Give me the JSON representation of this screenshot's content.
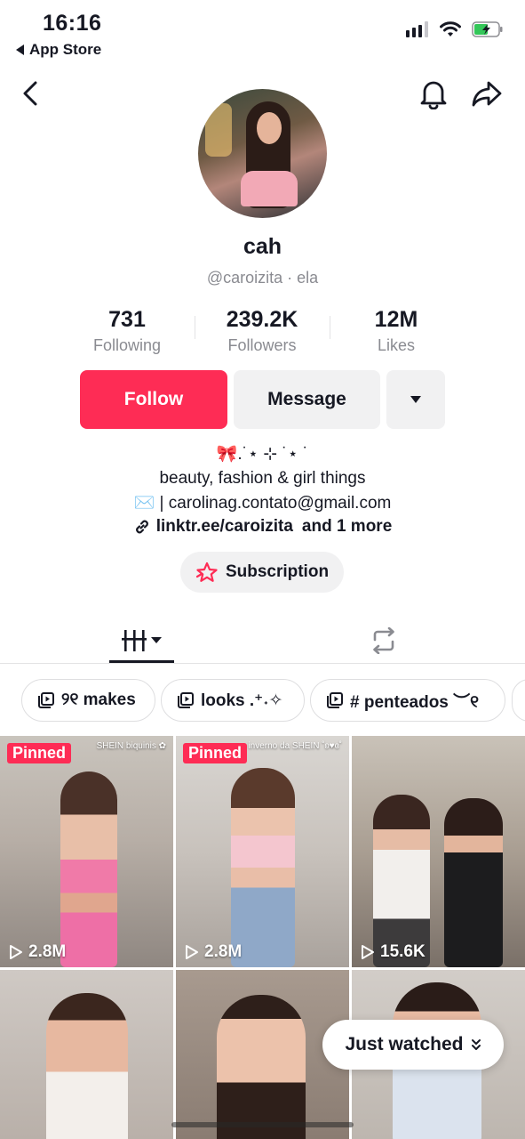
{
  "status_bar": {
    "time": "16:16",
    "back_app_label": "App Store"
  },
  "profile": {
    "display_name": "cah",
    "handle_line": "@caroizita · ela",
    "stats": [
      {
        "value": "731",
        "label": "Following"
      },
      {
        "value": "239.2K",
        "label": "Followers"
      },
      {
        "value": "12M",
        "label": "Likes"
      }
    ]
  },
  "actions": {
    "follow": "Follow",
    "message": "Message"
  },
  "bio": {
    "line1": "🎀.˙⋆ ⊹ ˙⋆ ˙",
    "line2": "beauty, fashion & girl things",
    "line3": "✉️ | carolinag.contato@gmail.com",
    "link_text": "linktr.ee/caroizita",
    "link_more": "and 1 more"
  },
  "subscription_label": "Subscription",
  "playlists": [
    {
      "label": "୨୧ makes"
    },
    {
      "label": "looks .⁺˖✧"
    },
    {
      "label": "# penteados ︶୧"
    }
  ],
  "videos": [
    {
      "pinned": "Pinned",
      "views": "2.8M",
      "caption": "SHEIN biquinis ✿"
    },
    {
      "pinned": "Pinned",
      "views": "2.8M",
      "caption": "inverno da SHEIN ˚ʚ♥ɞ˚"
    },
    {
      "views": "15.6K"
    },
    {},
    {},
    {}
  ],
  "just_watched": "Just watched",
  "colors": {
    "accent": "#fe2c55",
    "secondary_bg": "#f1f1f2",
    "text": "#161823",
    "muted": "#8a8b91"
  }
}
